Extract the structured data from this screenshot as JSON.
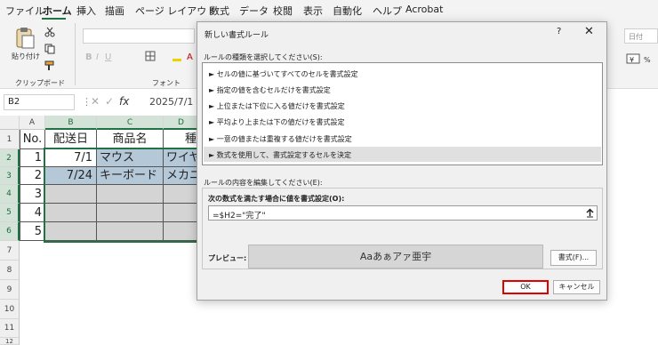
{
  "menu": {
    "items": [
      "ファイル",
      "ホーム",
      "挿入",
      "描画",
      "ページ レイアウト",
      "数式",
      "データ",
      "校閲",
      "表示",
      "自動化",
      "ヘルプ",
      "Acrobat"
    ]
  },
  "ribbon": {
    "paste_label": "貼り付け",
    "clipboard_group": "クリップボード",
    "font_group": "フォント",
    "date_format": "日付"
  },
  "formula_bar": {
    "name_box": "B2",
    "fx": "fx",
    "value": "2025/7/1"
  },
  "sheet": {
    "columns": [
      "A",
      "B",
      "C",
      "D"
    ],
    "rows": [
      "1",
      "2",
      "3",
      "4",
      "5",
      "6",
      "7",
      "8",
      "9",
      "10",
      "11",
      "12"
    ],
    "header_row": [
      "No.",
      "配送日",
      "商品名",
      "種"
    ],
    "data": [
      [
        "1",
        "7/1",
        "マウス",
        "ワイヤ"
      ],
      [
        "2",
        "7/24",
        "キーボード",
        "メカニ"
      ],
      [
        "3",
        "",
        "",
        ""
      ],
      [
        "4",
        "",
        "",
        ""
      ],
      [
        "5",
        "",
        "",
        ""
      ]
    ]
  },
  "dialog": {
    "title": "新しい書式ルール",
    "help": "?",
    "close": "✕",
    "rule_type_label": "ルールの種類を選択してください(S):",
    "rule_types": [
      "► セルの値に基づいてすべてのセルを書式設定",
      "► 指定の値を含むセルだけを書式設定",
      "► 上位または下位に入る値だけを書式設定",
      "► 平均より上または下の値だけを書式設定",
      "► 一意の値または重複する値だけを書式設定",
      "► 数式を使用して、書式設定するセルを決定"
    ],
    "selected_rule_index": 5,
    "edit_label": "ルールの内容を編集してください(E):",
    "formula_label": "次の数式を満たす場合に値を書式設定(O):",
    "formula_value": "=$H2=\"完了\"",
    "preview_label": "プレビュー:",
    "preview_text": "Aaあぁアァ亜宇",
    "format_button": "書式(F)...",
    "ok_button": "OK",
    "cancel_button": "キャンセル"
  },
  "colors": {
    "excel_green": "#217346",
    "highlight_blue": "#b4c8d8",
    "gray_fill": "#d4d4d4",
    "ok_highlight": "#e00000"
  }
}
